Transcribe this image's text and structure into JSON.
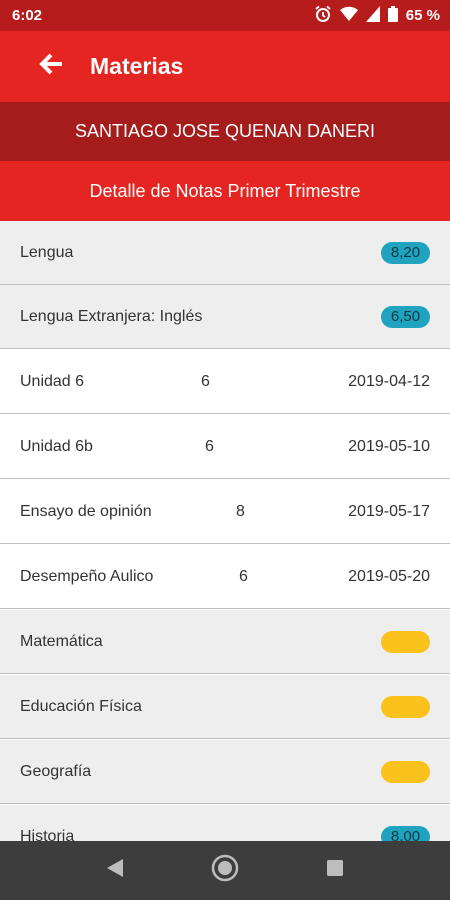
{
  "status_bar": {
    "time": "6:02",
    "battery": "65 %"
  },
  "app_bar": {
    "title": "Materias"
  },
  "student_name": "SANTIAGO JOSE QUENAN DANERI",
  "term_title": "Detalle de Notas Primer Trimestre",
  "colors": {
    "primary": "#e52521",
    "dark": "#a41c1c",
    "badge_teal": "#1fa3bf",
    "badge_yellow": "#fbc21b"
  },
  "rows": [
    {
      "kind": "subject",
      "label": "Lengua",
      "badge": "8,20",
      "badge_color": "teal"
    },
    {
      "kind": "subject",
      "label": "Lengua Extranjera: Inglés",
      "badge": "6,50",
      "badge_color": "teal"
    },
    {
      "kind": "grade",
      "label": "Unidad 6",
      "score": "6",
      "date": "2019-04-12"
    },
    {
      "kind": "grade",
      "label": "Unidad 6b",
      "score": "6",
      "date": "2019-05-10"
    },
    {
      "kind": "grade",
      "label": "Ensayo de opinión",
      "score": "8",
      "date": "2019-05-17"
    },
    {
      "kind": "grade",
      "label": "Desempeño Aulico",
      "score": "6",
      "date": "2019-05-20"
    },
    {
      "kind": "subject",
      "label": "Matemática",
      "badge": "",
      "badge_color": "yellow"
    },
    {
      "kind": "subject",
      "label": "Educación Física",
      "badge": "",
      "badge_color": "yellow"
    },
    {
      "kind": "subject",
      "label": "Geografía",
      "badge": "",
      "badge_color": "yellow"
    },
    {
      "kind": "subject",
      "label": "Historia",
      "badge": "8,00",
      "badge_color": "teal"
    }
  ]
}
